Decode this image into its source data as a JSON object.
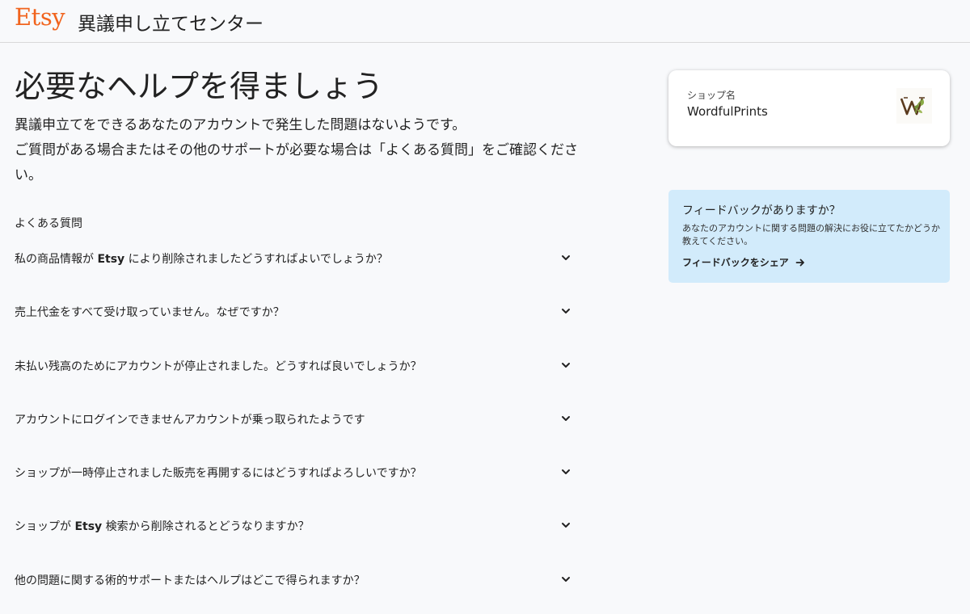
{
  "header": {
    "logo": "Etsy",
    "title": "異議申し立てセンター"
  },
  "main": {
    "title": "必要なヘルプを得ましょう",
    "intro_line1": "異議申立てをできるあなたのアカウントで発生した問題はないようです。",
    "intro_line2": "ご質問がある場合またはその他のサポートが必要な場合は「よくある質問」をご確認ください。"
  },
  "faq": {
    "heading": "よくある質問",
    "items": [
      {
        "pre": "私の商品情報が ",
        "bold": "Etsy",
        "post": " により削除されましたどうすればよいでしょうか？"
      },
      {
        "pre": "売上代金をすべて受け取っていません。なぜですか？",
        "bold": "",
        "post": ""
      },
      {
        "pre": "未払い残高のためにアカウントが停止されました。どうすれば良いでしょうか？",
        "bold": "",
        "post": ""
      },
      {
        "pre": "アカウントにログインできませんアカウントが乗っ取られたようです",
        "bold": "",
        "post": ""
      },
      {
        "pre": "ショップが一時停止されました販売を再開するにはどうすればよろしいですか？",
        "bold": "",
        "post": ""
      },
      {
        "pre": "ショップが ",
        "bold": "Etsy",
        "post": " 検索から削除されるとどうなりますか？"
      },
      {
        "pre": "他の問題に関する術的サポートまたはヘルプはどこで得られますか？",
        "bold": "",
        "post": ""
      }
    ]
  },
  "shop": {
    "label": "ショップ名",
    "name": "WordfulPrints",
    "avatar_icon": "wordfulprints-logo-icon"
  },
  "feedback": {
    "title": "フィードバックがありますか？",
    "body": "あなたのアカウントに関する問題の解決にお役に立てたかどうか教えてください。",
    "link_label": "フィードバックをシェア"
  },
  "colors": {
    "brand": "#f1641e",
    "feedback_bg": "#d2ebfb",
    "page_bg": "#f8f9fb"
  }
}
